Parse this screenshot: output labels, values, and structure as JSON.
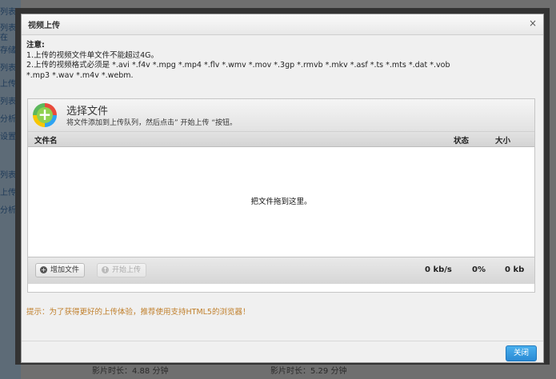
{
  "background": {
    "left_labels": [
      "列表",
      "列表在",
      "存储",
      "列表",
      "上传",
      "列表",
      "分析",
      "设置",
      "列表",
      "上传",
      "分析"
    ],
    "bottom_left": "影片时长：4.88 分钟",
    "bottom_right": "影片时长：5.29 分钟"
  },
  "dialog": {
    "title": "视频上传",
    "close_symbol": "×",
    "notes_head": "注意:",
    "note1": "1.上传的视频文件单文件不能超过4G。",
    "note2": "2.上传的视频格式必须是 *.avi *.f4v *.mpg *.mp4 *.flv *.wmv *.mov *.3gp *.rmvb *.mkv *.asf *.ts *.mts *.dat *.vob",
    "note3": "*.mp3 *.wav *.m4v *.webm.",
    "uploader": {
      "select_title": "选择文件",
      "select_sub": "将文件添加到上传队列，然后点击” 开始上传 “按钮。",
      "col_filename": "文件名",
      "col_status": "状态",
      "col_size": "大小",
      "drop_hint": "把文件拖到这里。",
      "add_button": "增加文件",
      "start_button": "开始上传",
      "speed": "0 kb/s",
      "percent": "0%",
      "total": "0 kb"
    },
    "tip": "提示：为了获得更好的上传体验，推荐使用支持HTML5的浏览器！",
    "close_button": "关闭"
  }
}
